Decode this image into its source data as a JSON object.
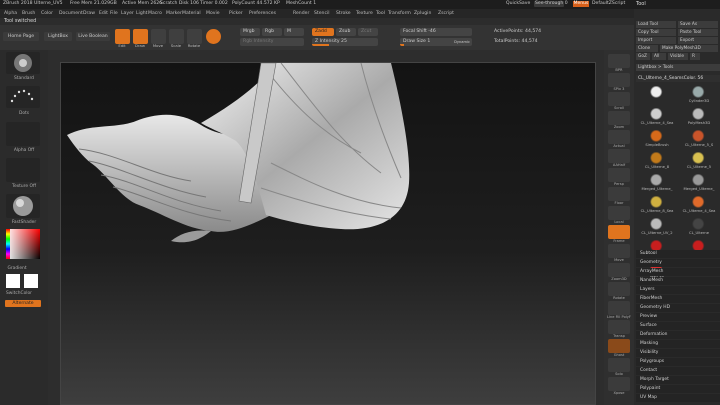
{
  "titlebar": {
    "app": "ZBrush 2018",
    "file": "Ulterne_UV5",
    "freemem": "Free Mem 21.029GB",
    "activemem": "Active Mem 2626",
    "scratch": "Scratch Disk 106",
    "timer": "Timer 0.002",
    "polycount": "PolyCount 44.572 KP",
    "meshcount": "MeshCount 1",
    "quicksave": "QuickSave",
    "seethrough": "See-through 0",
    "menus": "Menus",
    "script": "DefaultZScript"
  },
  "menubar": [
    "Alpha",
    "Brush",
    "Color",
    "Document",
    "Draw",
    "Edit",
    "File",
    "Layer",
    "Light",
    "Macro",
    "Marker",
    "Material",
    "Movie",
    "Picker",
    "Preferences",
    "Render",
    "Stencil",
    "Stroke",
    "Texture",
    "Tool",
    "Transform",
    "Zplugin",
    "Zscript"
  ],
  "status": "Tool switched",
  "toolbar": {
    "btns": [
      "Edit",
      "Draw",
      "Move",
      "Scale",
      "Rotate"
    ],
    "mrgb": "Mrgb",
    "rgb": "Rgb",
    "m": "M",
    "rgb_intensity": "Rgb Intensity",
    "zadd": "Zadd",
    "zsub": "Zsub",
    "zcut": "Zcut",
    "z_intensity": "Z Intensity 25",
    "focal": "Focal Shift -46",
    "drawsize": "Draw Size 1",
    "dynamic": "Dynamic",
    "active": "ActivePoints: 44,574",
    "total": "TotalPoints: 44,574"
  },
  "left": {
    "home": "Home Page",
    "lightbox": "LightBox",
    "liveboolean": "Live Boolean",
    "brush": "Standard",
    "stroke": "Dots",
    "alpha": "Alpha Off",
    "texture": "Texture Off",
    "material": "FastShader",
    "gradient": "Gradient",
    "switchcolor": "SwitchColor",
    "alternate": "Alternate"
  },
  "right": [
    "BPR",
    "SPix 3",
    "Scroll",
    "Zoom",
    "Actual",
    "AAHalf",
    "Persp",
    "Floor",
    "Local",
    "Frame",
    "Move",
    "Zoom3D",
    "Rotate",
    "Line Fill PolyF",
    "Transp",
    "Ghost",
    "Solo",
    "Xpose"
  ],
  "tool": {
    "title": "Tool",
    "btns": [
      "Load Tool",
      "Save As",
      "Copy Tool",
      "Paste Tool",
      "Import",
      "Export",
      "Clone",
      "Make PolyMesh3D",
      "GoZ",
      "All",
      "Visible",
      "R",
      "Lightbox > Tools"
    ],
    "current": "CL_Ulterne_4_SeamsColor. 56",
    "items": [
      "",
      "Cylinder3D",
      "CL_Ulterne_4_Sea",
      "PolyMesh3D",
      "SimpleBrush",
      "CL_Ulterne_5_S",
      "CL_Ulterne_8",
      "CL_Ulterne_5",
      "Merged_Ulterne_",
      "Merged_Ulterne_",
      "CL_Ulterne_8_Sea",
      "CL_Ulterne_4_Sea",
      "CL_Ulterne_UV_2",
      "CL_Ulterne",
      "ZSphere",
      "ZSphere_1",
      "MatCap"
    ],
    "subpalettes": [
      "Subtool",
      "Geometry",
      "ArrayMesh",
      "NanoMesh",
      "Layers",
      "FiberMesh",
      "Geometry HD",
      "Preview",
      "Surface",
      "Deformation",
      "Masking",
      "Visibility",
      "Polygroups",
      "Contact",
      "Morph Target",
      "Polypaint",
      "UV Map"
    ]
  },
  "colors": {
    "accent": "#e0741e",
    "panel": "#2c2c2c",
    "canvas_top": "#131313",
    "canvas_bottom": "#3e3e3e"
  }
}
